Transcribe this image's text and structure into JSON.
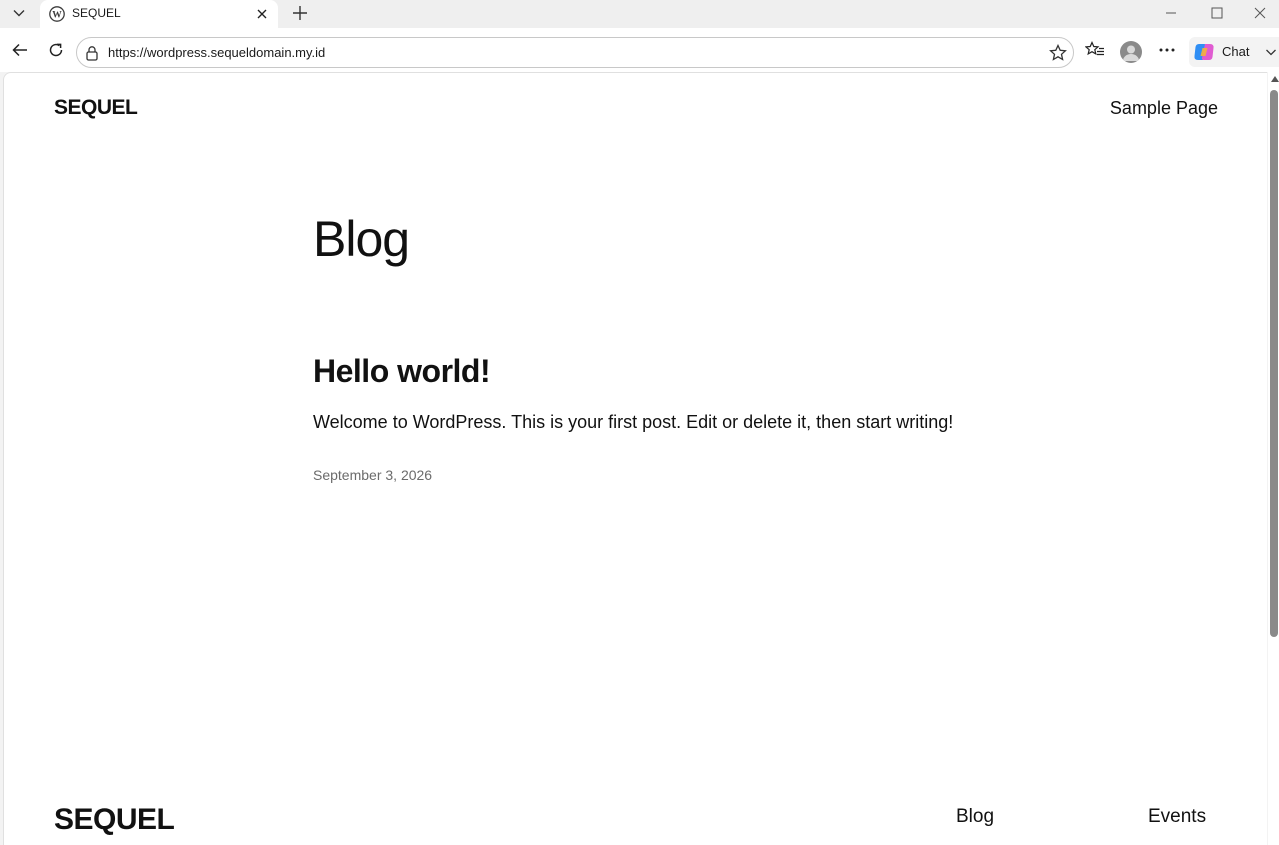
{
  "browser": {
    "tab": {
      "title": "SEQUEL"
    },
    "address": {
      "url": "https://wordpress.sequeldomain.my.id"
    },
    "chat_label": "Chat"
  },
  "page": {
    "site_title": "SEQUEL",
    "header_nav": [
      "Sample Page"
    ],
    "heading": "Blog",
    "posts": [
      {
        "title": "Hello world!",
        "excerpt": "Welcome to WordPress. This is your first post. Edit or delete it, then start writing!",
        "date": "September 3, 2026"
      }
    ],
    "footer": {
      "site_title": "SEQUEL",
      "nav": [
        "Blog",
        "Events"
      ]
    }
  },
  "icons": {
    "tab_list": "chevron-down-icon",
    "favicon": "wordpress-icon",
    "close_tab": "close-icon",
    "new_tab": "plus-icon",
    "back": "arrow-left-icon",
    "reload": "reload-icon",
    "lock": "lock-icon",
    "favorite": "star-icon",
    "favorites": "favorites-icon",
    "profile": "avatar-icon",
    "more": "more-icon",
    "copilot": "copilot-icon"
  }
}
